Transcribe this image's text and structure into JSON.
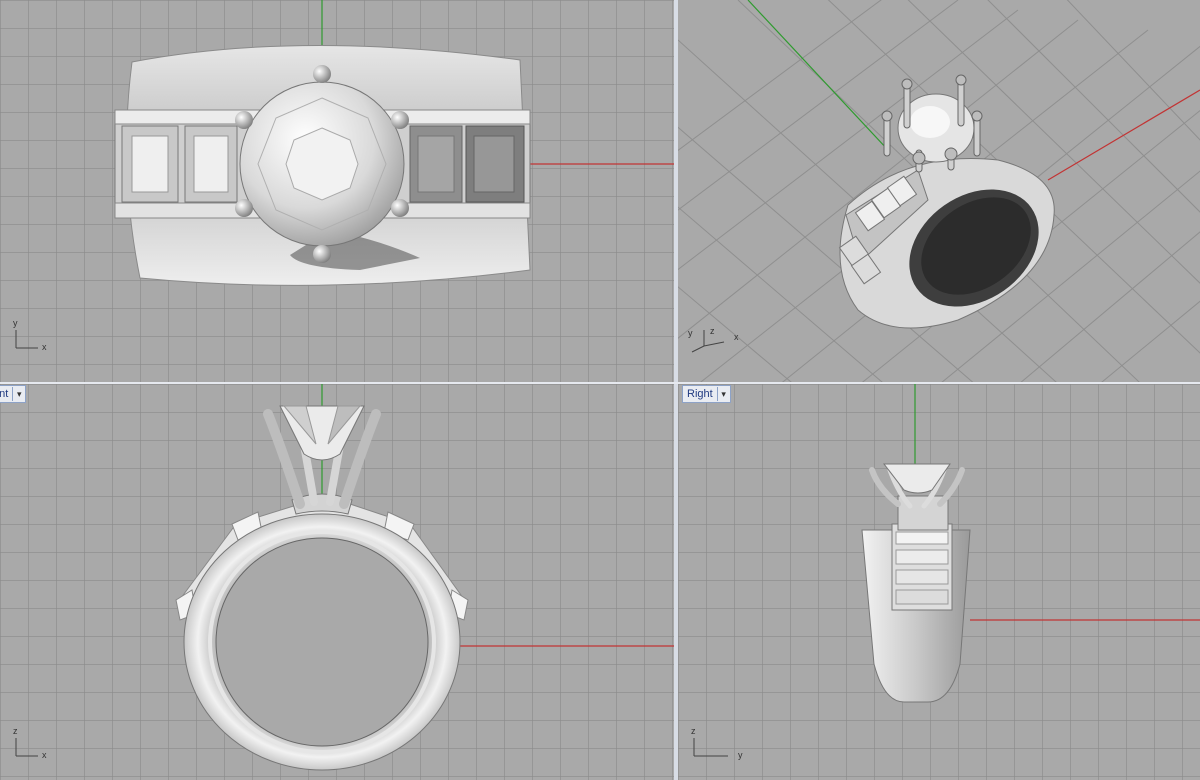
{
  "viewports": {
    "top": {
      "axis": {
        "h": "x",
        "v": "y"
      }
    },
    "perspective": {
      "axis": {
        "a": "y",
        "b": "z",
        "c": "x"
      }
    },
    "front": {
      "title": "ont",
      "axis": {
        "h": "x",
        "v": "z"
      }
    },
    "right": {
      "title": "Right",
      "axis": {
        "h": "y",
        "v": "z"
      }
    }
  },
  "colors": {
    "grid_bg": "#a9a9a9",
    "grid_line": "#8c8c8c",
    "x_axis": "#c23434",
    "y_axis": "#2f9b2f",
    "model": "#d8d8d8",
    "title_bar": "#e9ecf2"
  },
  "icons": {
    "viewport_menu": "dropdown-arrow-icon"
  }
}
